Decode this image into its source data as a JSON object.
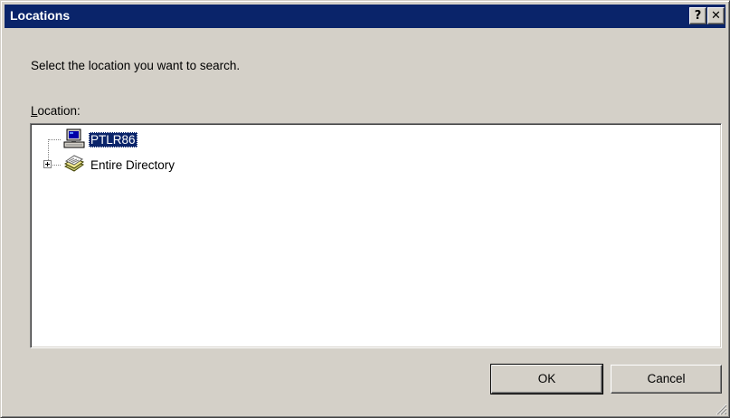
{
  "window": {
    "title": "Locations",
    "help_glyph": "?",
    "close_glyph": "✕",
    "title_bar_color": "#0a246a",
    "face_color": "#d4d0c8"
  },
  "instruction": "Select the location you want to search.",
  "location_label": {
    "accel": "L",
    "rest": "ocation:"
  },
  "tree": {
    "items": [
      {
        "label": "PTLR86",
        "icon": "computer-icon",
        "selected": true,
        "expandable": false
      },
      {
        "label": "Entire Directory",
        "icon": "directory-icon",
        "selected": false,
        "expandable": true,
        "expander_state": "collapsed"
      }
    ],
    "selection_color": "#0a246a"
  },
  "buttons": {
    "ok_label": "OK",
    "cancel_label": "Cancel"
  }
}
